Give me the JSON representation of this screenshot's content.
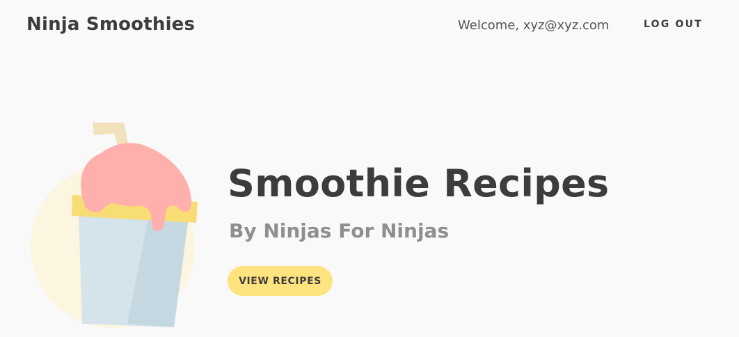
{
  "navbar": {
    "brand": "Ninja Smoothies",
    "welcome_text": "Welcome, xyz@xyz.com",
    "logout_label": "LOG OUT"
  },
  "hero": {
    "title": "Smoothie Recipes",
    "subtitle": "By Ninjas For Ninjas",
    "button_label": "VIEW RECIPES",
    "illustration_icon": "smoothie-cup-icon"
  },
  "colors": {
    "background": "#f9f9f9",
    "accent": "#ffe37f",
    "text_dark": "#3c3c3c",
    "text_muted": "#8f8f8f",
    "smoothie_pink": "#ffb0ac",
    "cup_blue": "#d5e3eb",
    "straw": "#f1e2bb"
  }
}
